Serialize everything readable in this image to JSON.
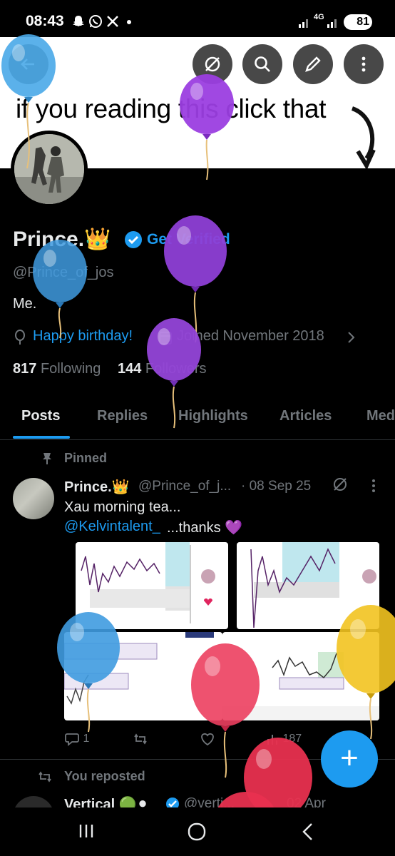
{
  "status_bar": {
    "time": "08:43",
    "notification_icons": [
      "snapchat-icon",
      "whatsapp-icon",
      "x-icon",
      "dot-icon"
    ],
    "signal_label": "4G",
    "battery": "81"
  },
  "banner": {
    "text": "if you reading this click that"
  },
  "header_buttons": [
    "back-icon",
    "grok-icon",
    "search-icon",
    "edit-icon",
    "more-icon"
  ],
  "profile": {
    "name": "Prince.👑",
    "get_verified": "Get Verified",
    "handle": "@Prince_of_jos",
    "bio": "Me.",
    "birthday": "Happy birthday!",
    "joined": "Joined November 2018",
    "following_count": "817",
    "following_label": "Following",
    "followers_count": "144",
    "followers_label": "Followers"
  },
  "tabs": [
    {
      "label": "Posts",
      "active": true
    },
    {
      "label": "Replies"
    },
    {
      "label": "Highlights"
    },
    {
      "label": "Articles"
    },
    {
      "label": "Med"
    }
  ],
  "pinned_post": {
    "pinned_label": "Pinned",
    "author_name": "Prince.👑",
    "author_handle": "@Prince_of_j...",
    "date": "· 08 Sep 25",
    "text": "Xau morning tea...",
    "mention": "@Kelvintalent_",
    "text_after": "...thanks 💜",
    "actions": {
      "replies": "1",
      "reposts": "",
      "likes": "",
      "views": "187"
    }
  },
  "next_post": {
    "repost_label": "You reposted",
    "author_name": "Vertical 🟢⚫",
    "author_handle": "@verti...",
    "date": "02 Apr"
  },
  "fab_label": "+",
  "colors": {
    "accent": "#1d9bf0",
    "background": "#000000",
    "text": "#e7e9ea",
    "muted": "#71767b"
  }
}
